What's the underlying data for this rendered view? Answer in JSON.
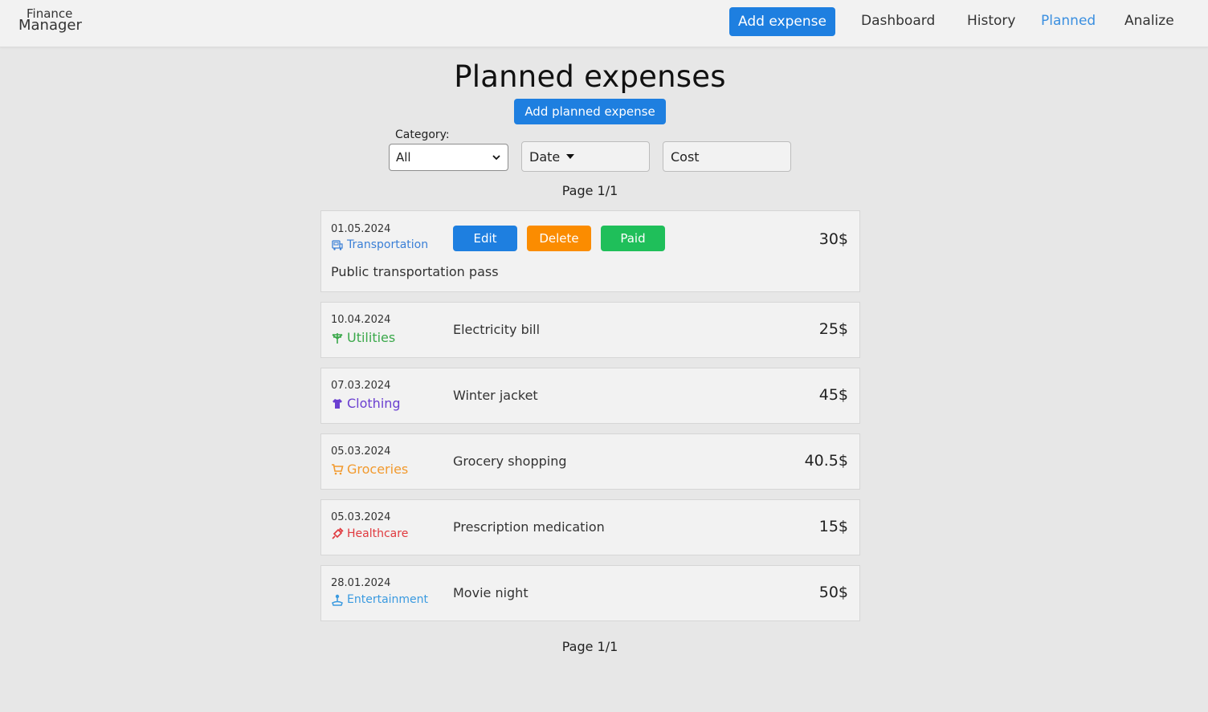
{
  "nav": {
    "brand_line1": "Finance",
    "brand_line2": "Manager",
    "add_expense": "Add expense",
    "links": [
      "Dashboard",
      "History",
      "Planned",
      "Analize"
    ],
    "active": "Planned"
  },
  "page": {
    "title": "Planned expenses",
    "add_planned": "Add planned expense",
    "category_label": "Category:",
    "category_value": "All",
    "date_sort": "Date",
    "cost_sort": "Cost",
    "pager_top": "Page 1/1",
    "pager_bottom": "Page 1/1"
  },
  "actions": {
    "edit": "Edit",
    "delete": "Delete",
    "paid": "Paid"
  },
  "expenses": [
    {
      "date": "01.05.2024",
      "category": "Transportation",
      "color": "#3a7fd6",
      "icon": "bus-icon",
      "description": "Public transportation pass",
      "amount": "30$"
    },
    {
      "date": "10.04.2024",
      "category": "Utilities",
      "color": "#3aa84a",
      "icon": "power-pole-icon",
      "description": "Electricity bill",
      "amount": "25$"
    },
    {
      "date": "07.03.2024",
      "category": "Clothing",
      "color": "#6a3fd0",
      "icon": "shirt-icon",
      "description": "Winter jacket",
      "amount": "45$"
    },
    {
      "date": "05.03.2024",
      "category": "Groceries",
      "color": "#f29a2e",
      "icon": "cart-icon",
      "description": "Grocery shopping",
      "amount": "40.5$"
    },
    {
      "date": "05.03.2024",
      "category": "Healthcare",
      "color": "#e0393e",
      "icon": "syringe-icon",
      "description": "Prescription medication",
      "amount": "15$"
    },
    {
      "date": "28.01.2024",
      "category": "Entertainment",
      "color": "#3a9ae0",
      "icon": "joystick-icon",
      "description": "Movie night",
      "amount": "50$"
    }
  ]
}
